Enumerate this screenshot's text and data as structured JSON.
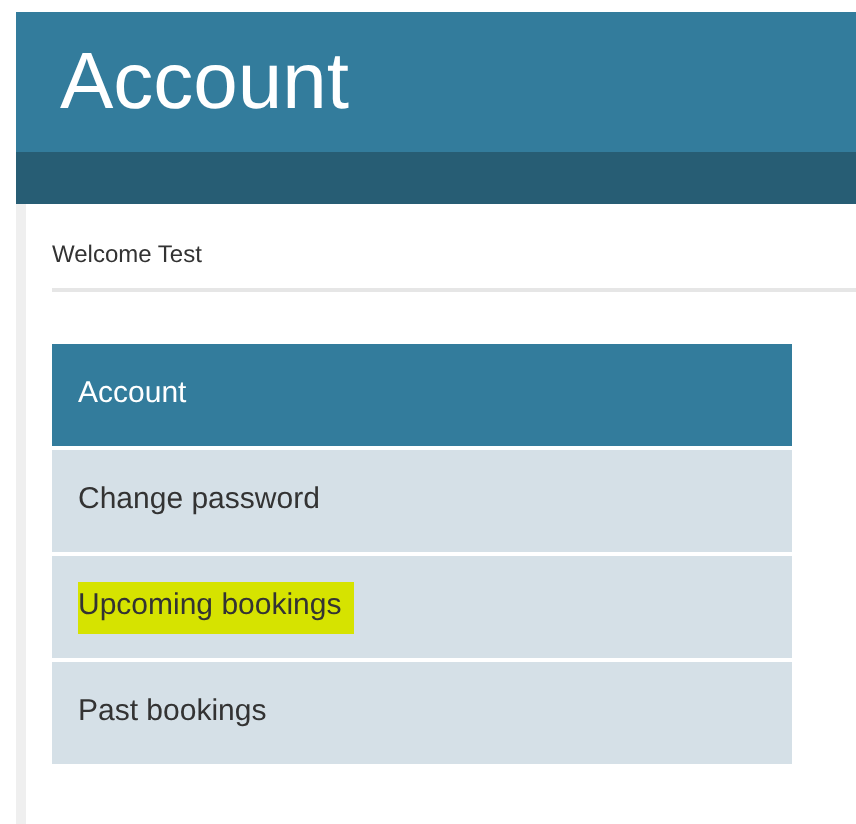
{
  "header": {
    "title": "Account"
  },
  "welcome": "Welcome Test",
  "menu": [
    {
      "label": "Account",
      "selected": true,
      "highlighted": false
    },
    {
      "label": "Change password",
      "selected": false,
      "highlighted": false
    },
    {
      "label": "Upcoming bookings",
      "selected": false,
      "highlighted": true
    },
    {
      "label": "Past bookings",
      "selected": false,
      "highlighted": false
    }
  ]
}
